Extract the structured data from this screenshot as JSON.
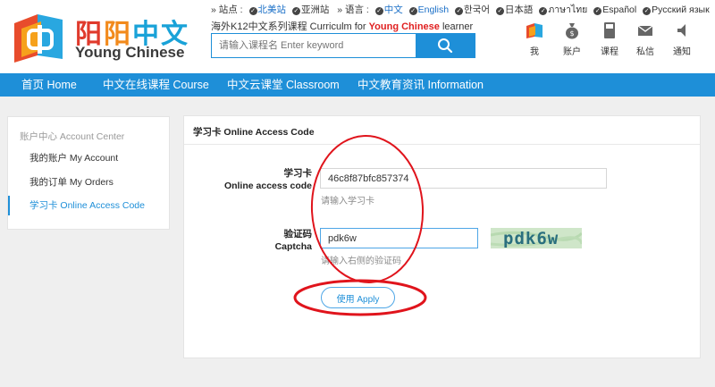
{
  "brand": {
    "cn_part1": "阳",
    "cn_part2": "阳",
    "cn_part3": "中文",
    "en": "Young Chinese"
  },
  "top_bar": {
    "site_label": "» 站点 :",
    "site_current": "北美站",
    "site_other": "亚洲站",
    "lang_label": "» 语言 :",
    "languages": [
      "中文",
      "English",
      "한국어",
      "日本語",
      "ภาษาไทย",
      "Español",
      "Русский язык"
    ]
  },
  "tagline": {
    "prefix": "海外K12中文系列课程 Curriculm for ",
    "highlight": "Young Chinese",
    "suffix": " learner"
  },
  "search": {
    "placeholder": "请输入课程名 Enter keyword"
  },
  "header_nav": [
    {
      "label": "我",
      "icon": "user-logo-icon"
    },
    {
      "label": "账户",
      "icon": "money-bag-icon"
    },
    {
      "label": "课程",
      "icon": "book-icon"
    },
    {
      "label": "私信",
      "icon": "envelope-icon"
    },
    {
      "label": "通知",
      "icon": "speaker-icon"
    }
  ],
  "navbar": {
    "items": [
      "首页 Home",
      "中文在线课程 Course",
      "中文云课堂 Classroom",
      "中文教育资讯 Information"
    ]
  },
  "sidebar": {
    "title": "账户中心 Account Center",
    "items": [
      "我的账户 My Account",
      "我的订单 My Orders",
      "学习卡 Online Access Code"
    ]
  },
  "form": {
    "title": "学习卡 Online Access Code",
    "code_label_cn": "学习卡",
    "code_label_en": "Online access code",
    "code_value": "46c8f87bfc857374",
    "code_hint": "请输入学习卡",
    "captcha_label_cn": "验证码",
    "captcha_label_en": "Captcha",
    "captcha_value": "pdk6w",
    "captcha_hint": "请输入右侧的验证码",
    "captcha_image_text": "pdk6w",
    "apply_label": "使用 Apply"
  },
  "colors": {
    "primary": "#1e8fd8",
    "annotation": "#e0141c"
  }
}
